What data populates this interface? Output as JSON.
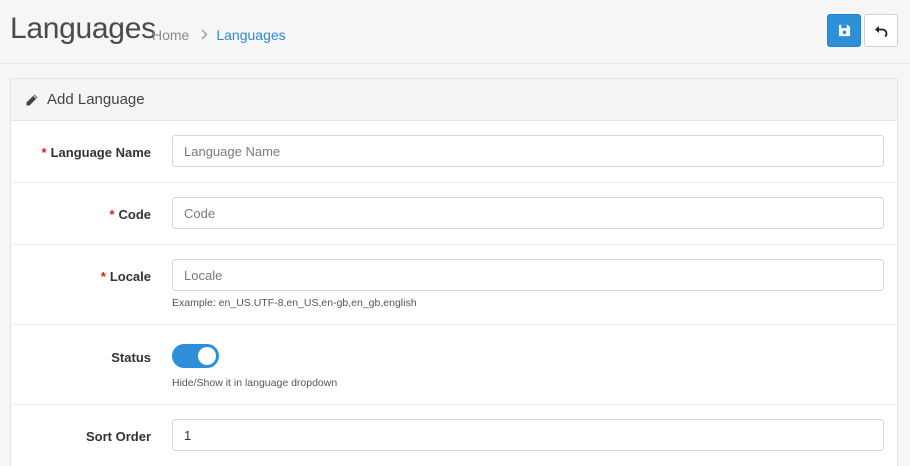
{
  "header": {
    "title": "Languages",
    "breadcrumb": {
      "home": "Home",
      "separator": "›",
      "current": "Languages"
    },
    "buttons": {
      "save_icon": "save-icon",
      "back_icon": "undo-back-icon"
    }
  },
  "card": {
    "icon": "pencil-icon",
    "title": "Add Language"
  },
  "form": {
    "required_mark": "*",
    "language_name": {
      "label": "Language Name",
      "placeholder": "Language Name",
      "value": ""
    },
    "code": {
      "label": "Code",
      "placeholder": "Code",
      "value": ""
    },
    "locale": {
      "label": "Locale",
      "placeholder": "Locale",
      "value": "",
      "help": "Example: en_US.UTF-8,en_US,en-gb,en_gb,english"
    },
    "status": {
      "label": "Status",
      "enabled": true,
      "help": "Hide/Show it in language dropdown"
    },
    "sort_order": {
      "label": "Sort Order",
      "value": "1"
    }
  },
  "colors": {
    "primary": "#2c8fd8",
    "required": "#d21f1f",
    "link": "#2a8ad6"
  }
}
